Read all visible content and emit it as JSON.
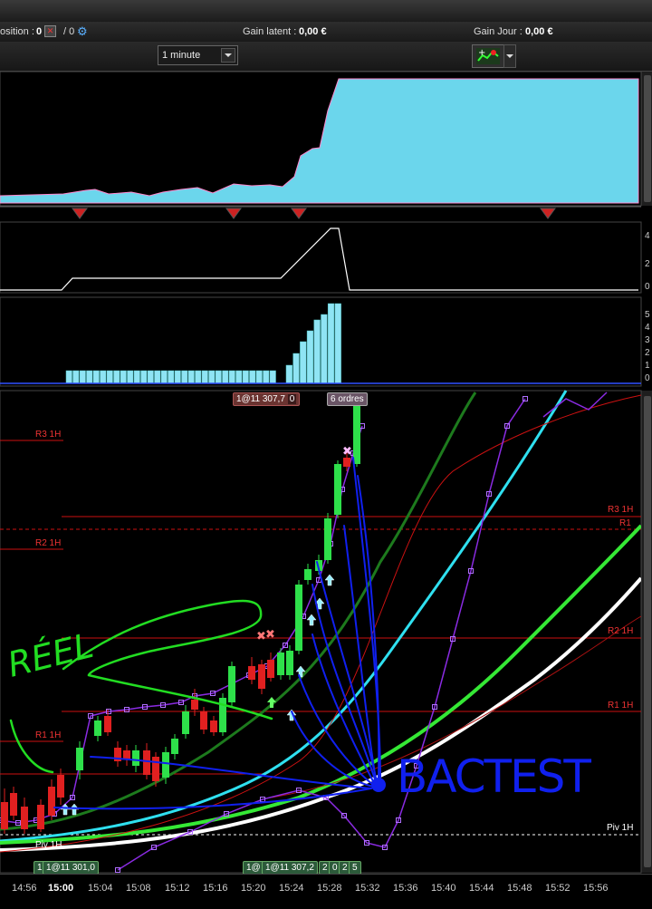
{
  "status": {
    "position_label": "osition : ",
    "position_value": "0",
    "orders_value": "/ 0",
    "gain_latent_label": "Gain latent : ",
    "gain_latent_value": "0,00 €",
    "gain_jour_label": "Gain Jour : ",
    "gain_jour_value": "0,00 €"
  },
  "toolbar": {
    "timeframe": "1 minute"
  },
  "panels": {
    "indicator2_scale": [
      "4",
      "2",
      "0"
    ],
    "volume_scale": [
      "5",
      "4",
      "3",
      "2",
      "1",
      "0"
    ]
  },
  "tags": {
    "order_top": "1@11 307,7",
    "order_top_right": "0",
    "orders_count": "6 ordres",
    "bottom_left_1": "1",
    "bottom_left_2": "1@11 301,0",
    "bottom_mid_1": "1@",
    "bottom_mid_2": "1@11 307,2",
    "bottom_mid_3": "2",
    "bottom_mid_4": "0",
    "bottom_mid_5": "2",
    "bottom_mid_6": "5"
  },
  "levels": {
    "r3_1h_left": "R3 1H",
    "r2_1h_left": "R2 1H",
    "r1_1h_left": "R1 1H",
    "piv_1h_left": "Piv 1H",
    "r3_1h_right": "R3 1H",
    "r1_right": "R1",
    "r2_1h_right": "R2 1H",
    "r1_1h_right": "R1 1H",
    "piv_1h_right": "Piv 1H"
  },
  "annotations": {
    "reel": "RÉEL",
    "bactest": "BACTEST"
  },
  "time_axis": [
    "14:56",
    "15:00",
    "15:04",
    "15:08",
    "15:12",
    "15:16",
    "15:20",
    "15:24",
    "15:28",
    "15:32",
    "15:36",
    "15:40",
    "15:44",
    "15:48",
    "15:52",
    "15:56"
  ],
  "colors": {
    "area_fill": "#6bd6ec",
    "volume_bar": "#8fe4f4",
    "bull_candle": "#2ee04a",
    "bear_candle": "#e02020",
    "level_line": "#cc1111",
    "annotation_green": "#22dd22",
    "annotation_blue": "#1020ee"
  }
}
